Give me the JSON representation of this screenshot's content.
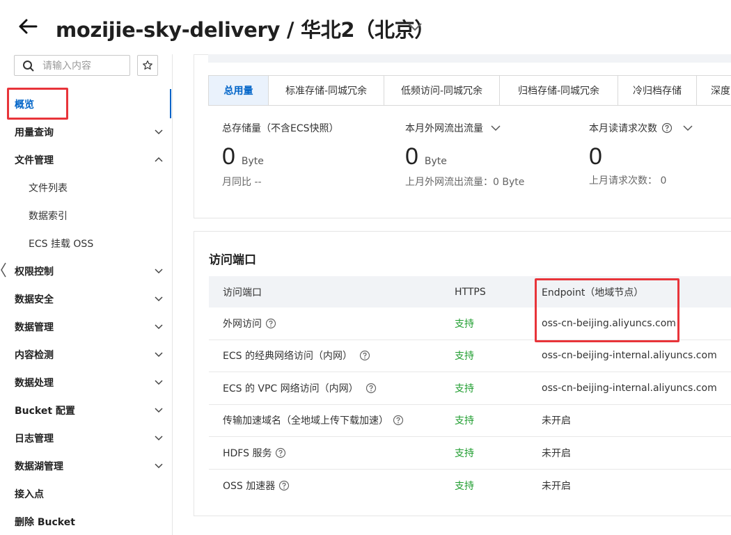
{
  "header": {
    "title": "mozijie-sky-delivery / 华北2（北京）"
  },
  "sidebar": {
    "search_placeholder": "请输入内容",
    "items": [
      {
        "label": "概览",
        "active": true
      },
      {
        "label": "用量查询"
      },
      {
        "label": "文件管理",
        "expanded": true,
        "children": [
          "文件列表",
          "数据索引",
          "ECS 挂载 OSS"
        ]
      },
      {
        "label": "权限控制"
      },
      {
        "label": "数据安全"
      },
      {
        "label": "数据管理"
      },
      {
        "label": "内容检测"
      },
      {
        "label": "数据处理"
      },
      {
        "label": "Bucket 配置"
      },
      {
        "label": "日志管理"
      },
      {
        "label": "数据湖管理"
      },
      {
        "label": "接入点"
      },
      {
        "label": "删除 Bucket"
      }
    ]
  },
  "usage": {
    "tabs": [
      "总用量",
      "标准存储-同城冗余",
      "低频访问-同城冗余",
      "归档存储-同城冗余",
      "冷归档存储",
      "深度"
    ],
    "active_tab": "总用量",
    "stats": [
      {
        "label": "总存储量（不含ECS快照）",
        "value": "0",
        "unit": "Byte",
        "sub": "月同比 --"
      },
      {
        "label": "本月外网流出流量",
        "value": "0",
        "unit": "Byte",
        "sub": "上月外网流出流量：0 Byte"
      },
      {
        "label": "本月读请求次数",
        "value": "0",
        "unit": "",
        "sub": "上月请求次数：  0"
      }
    ]
  },
  "access": {
    "title": "访问端口",
    "columns": [
      "访问端口",
      "HTTPS",
      "Endpoint（地域节点）"
    ],
    "rows": [
      {
        "port": "外网访问",
        "https": "支持",
        "endpoint": "oss-cn-beijing.aliyuncs.com"
      },
      {
        "port": "ECS 的经典网络访问（内网）",
        "https": "支持",
        "endpoint": "oss-cn-beijing-internal.aliyuncs.com"
      },
      {
        "port": "ECS 的 VPC 网络访问（内网）",
        "https": "支持",
        "endpoint": "oss-cn-beijing-internal.aliyuncs.com"
      },
      {
        "port": "传输加速域名（全地域上传下载加速）",
        "https": "支持",
        "endpoint": "未开启"
      },
      {
        "port": "HDFS 服务",
        "https": "支持",
        "endpoint": "未开启"
      },
      {
        "port": "OSS 加速器",
        "https": "支持",
        "endpoint": "未开启"
      }
    ]
  },
  "colors": {
    "accent": "#0064c8",
    "support_green": "#1f9d2f",
    "annotation_red": "#e8343a"
  }
}
